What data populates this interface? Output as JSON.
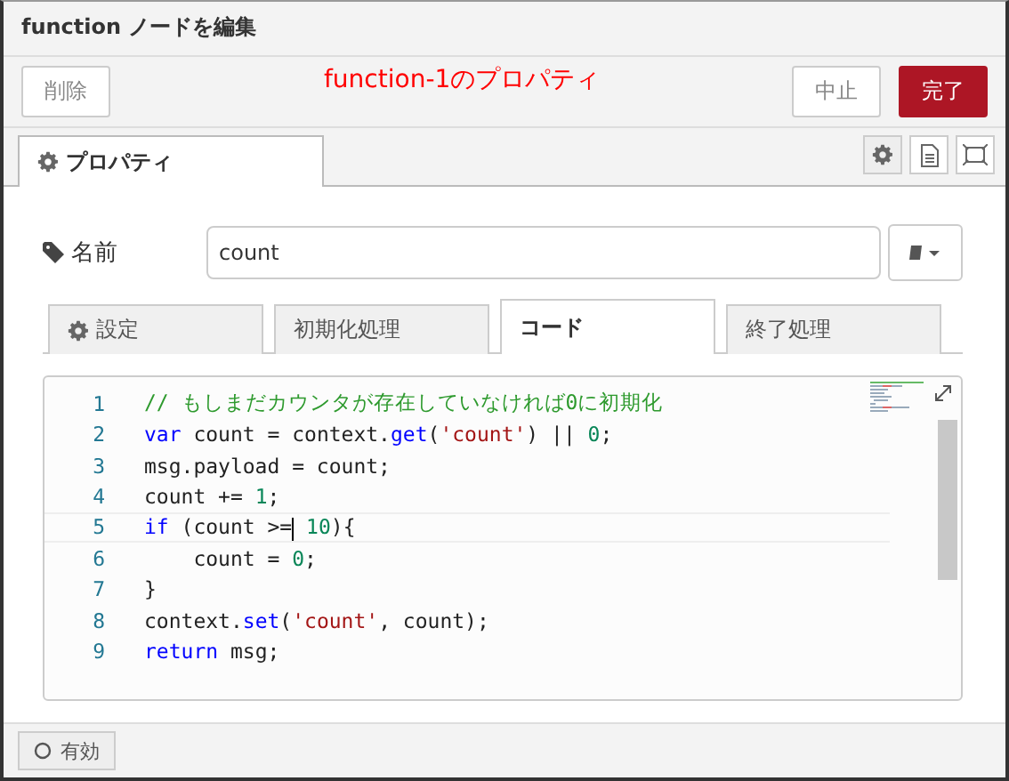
{
  "window": {
    "title": "function ノードを編集"
  },
  "toolbar": {
    "buttons": [
      {
        "label": "削除",
        "kind": "plain"
      },
      {
        "label": "中止",
        "kind": "plain"
      },
      {
        "label": "完了",
        "kind": "primary"
      }
    ],
    "annotation": "function-1のプロパティ"
  },
  "tabs": [
    {
      "label": "プロパティ",
      "selected": true
    }
  ],
  "name_field": {
    "label": "名前",
    "value": "count"
  },
  "sub_tabs": [
    {
      "label": "設定",
      "icon": true,
      "selected": false
    },
    {
      "label": "初期化処理",
      "icon": false,
      "selected": false
    },
    {
      "label": "コード",
      "icon": false,
      "selected": true
    },
    {
      "label": "終了処理",
      "icon": false,
      "selected": false
    }
  ],
  "editor": {
    "lines": [
      {
        "number": "1",
        "active": false,
        "tokens": [
          {
            "kind": "comment",
            "text": "// もしまだカウンタが存在していなければ0に初期化"
          }
        ]
      },
      {
        "number": "2",
        "active": false,
        "tokens": [
          {
            "kind": "keyword",
            "text": "var"
          },
          {
            "kind": "plain",
            "text": " count = context."
          },
          {
            "kind": "keyword",
            "text": "get"
          },
          {
            "kind": "plain",
            "text": "("
          },
          {
            "kind": "string",
            "text": "'count'"
          },
          {
            "kind": "plain",
            "text": ") || "
          },
          {
            "kind": "number",
            "text": "0"
          },
          {
            "kind": "plain",
            "text": ";"
          }
        ]
      },
      {
        "number": "3",
        "active": false,
        "tokens": [
          {
            "kind": "plain",
            "text": "msg.payload = count;"
          }
        ]
      },
      {
        "number": "4",
        "active": false,
        "tokens": [
          {
            "kind": "plain",
            "text": "count += "
          },
          {
            "kind": "number",
            "text": "1"
          },
          {
            "kind": "plain",
            "text": ";"
          }
        ]
      },
      {
        "number": "5",
        "active": true,
        "tokens": [
          {
            "kind": "keyword",
            "text": "if"
          },
          {
            "kind": "plain",
            "text": " (count >="
          },
          {
            "kind": "cursor"
          },
          {
            "kind": "number",
            "text": " 10"
          },
          {
            "kind": "plain",
            "text": "){"
          }
        ]
      },
      {
        "number": "6",
        "active": false,
        "tokens": [
          {
            "kind": "plain",
            "text": "    count = "
          },
          {
            "kind": "number",
            "text": "0"
          },
          {
            "kind": "plain",
            "text": ";"
          }
        ]
      },
      {
        "number": "7",
        "active": false,
        "tokens": [
          {
            "kind": "plain",
            "text": "}"
          }
        ]
      },
      {
        "number": "8",
        "active": false,
        "tokens": [
          {
            "kind": "plain",
            "text": "context."
          },
          {
            "kind": "keyword",
            "text": "set"
          },
          {
            "kind": "plain",
            "text": "("
          },
          {
            "kind": "string",
            "text": "'count'"
          },
          {
            "kind": "plain",
            "text": ", count);"
          }
        ]
      },
      {
        "number": "9",
        "active": false,
        "tokens": [
          {
            "kind": "keyword",
            "text": "return"
          },
          {
            "kind": "plain",
            "text": " msg;"
          }
        ]
      }
    ]
  },
  "footer": {
    "toggle": {
      "label": "有効",
      "on": false
    }
  }
}
